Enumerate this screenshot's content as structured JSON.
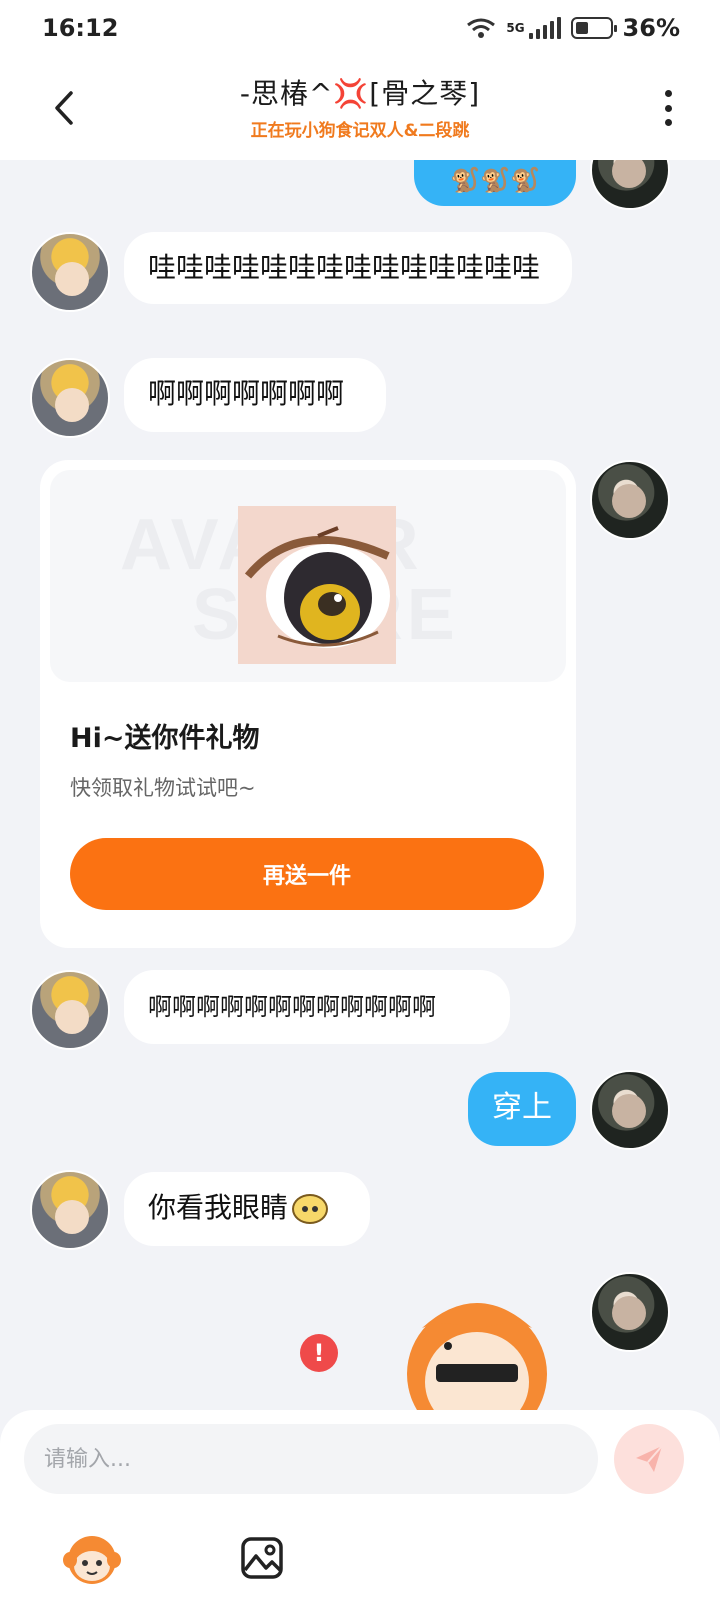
{
  "status_bar": {
    "time": "16:12",
    "network": "5G",
    "battery": "36%"
  },
  "header": {
    "title": "-思椿^💢[骨之琴]",
    "subtitle": "正在玩小狗食记双人&二段跳"
  },
  "messages": {
    "top_partial_me": "🐒🐒🐒",
    "m1_them": "哇哇哇哇哇哇哇哇哇哇哇哇哇哇",
    "m2_them": "啊啊啊啊啊啊啊",
    "m4_them": "啊啊啊啊啊啊啊啊啊啊啊啊",
    "m5_me": "穿上",
    "m6_them": "你看我眼睛"
  },
  "gift_card": {
    "title": "Hi~送你件礼物",
    "description": "快领取礼物试试吧~",
    "button_label": "再送一件"
  },
  "input": {
    "placeholder": "请输入..."
  },
  "colors": {
    "accent_orange": "#fb7212",
    "my_bubble": "#35b3f6",
    "subtitle_orange": "#f07a1e",
    "error_red": "#ef4a4a"
  },
  "icons": {
    "back": "chevron-left-icon",
    "more": "more-vertical-icon",
    "send": "send-icon",
    "sticker": "monkey-sticker-icon",
    "image": "image-icon",
    "error": "exclamation-icon"
  }
}
